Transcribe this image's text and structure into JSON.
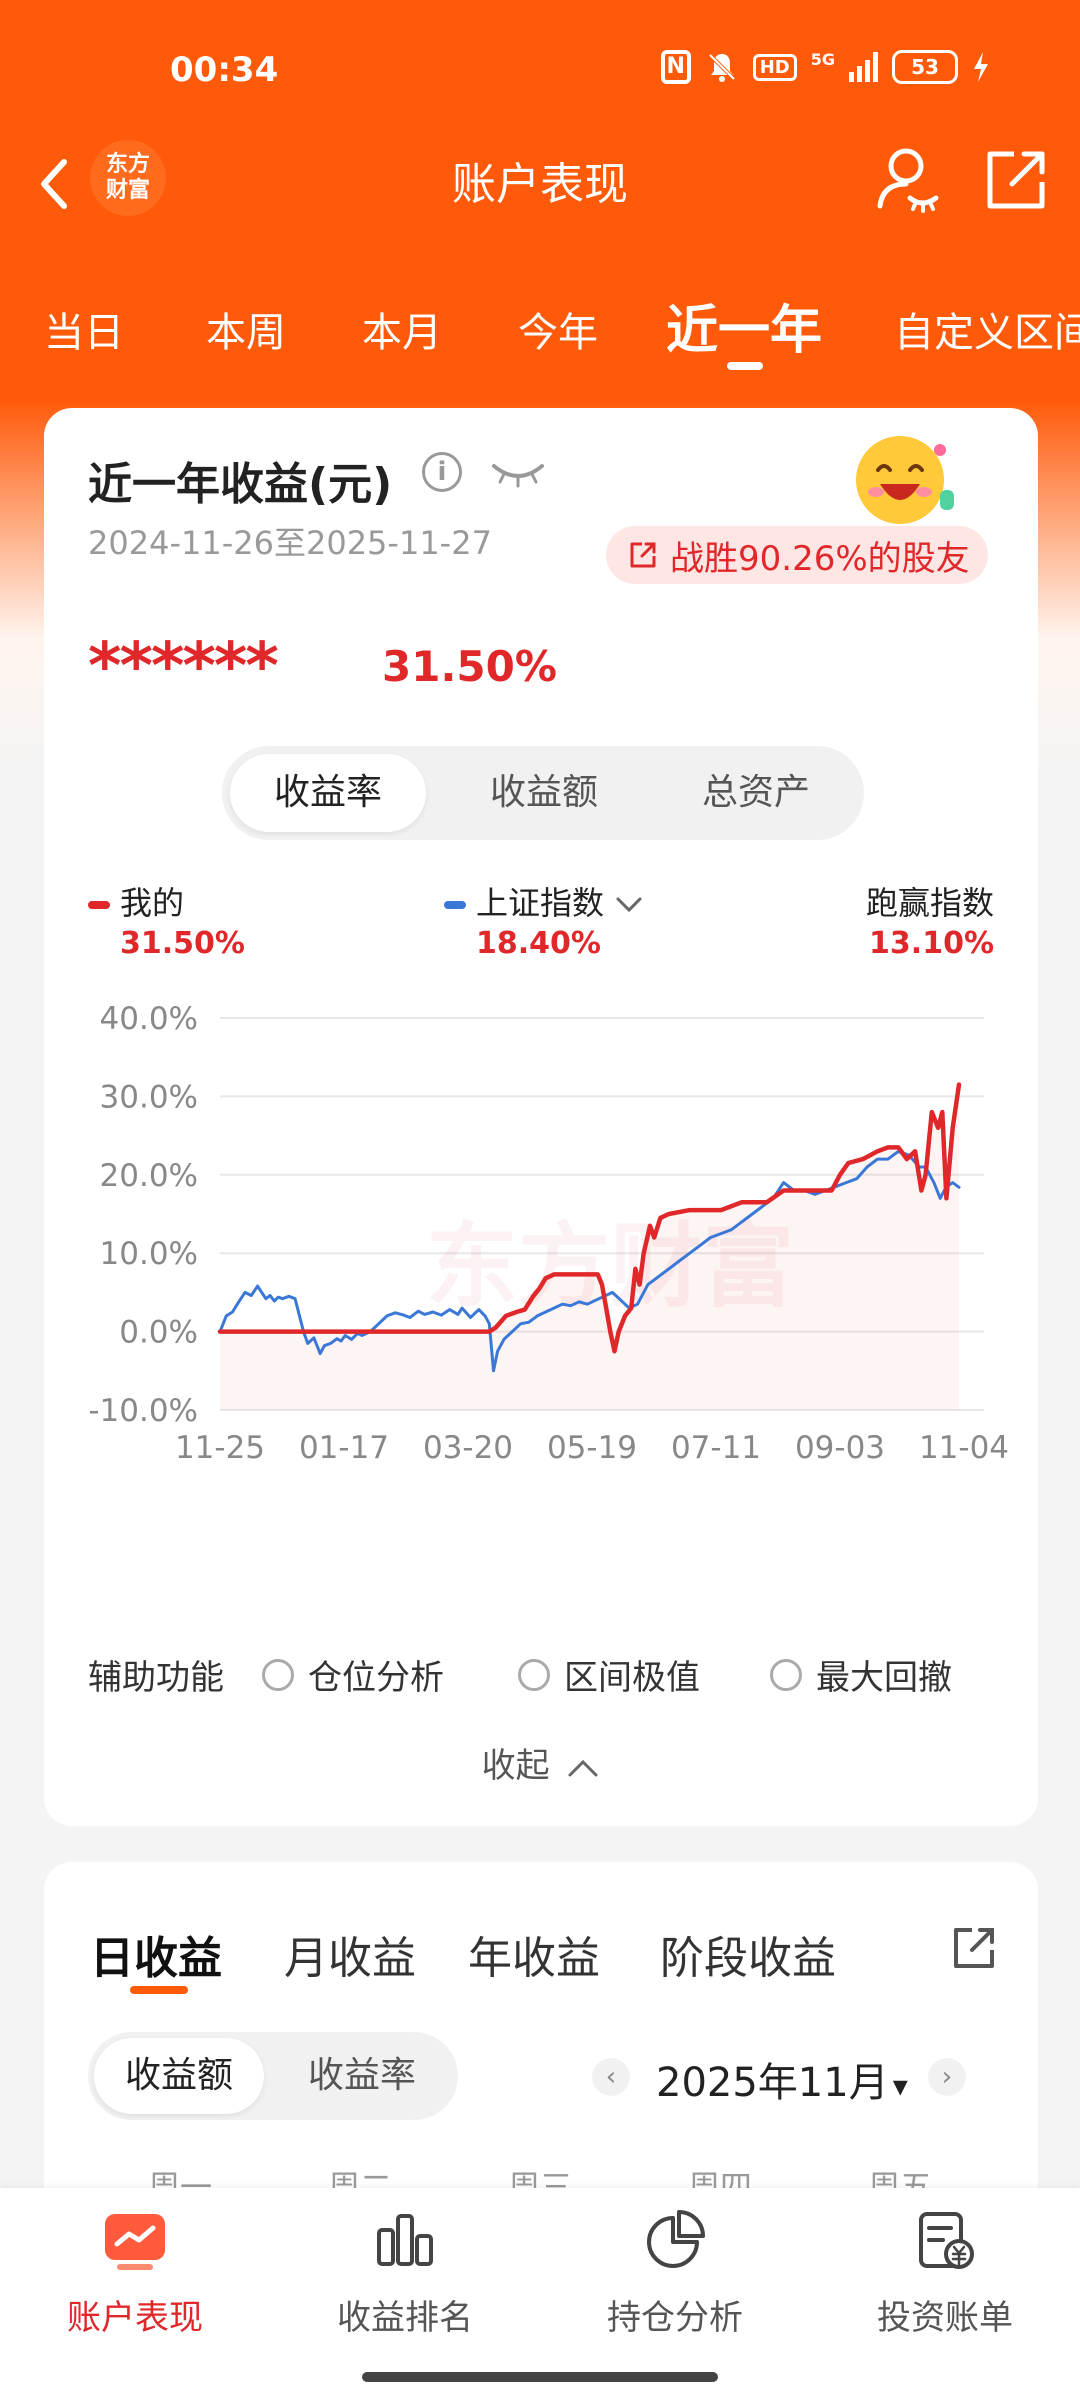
{
  "status_bar": {
    "time": "00:34",
    "network": "5G",
    "hd": "HD",
    "nfc": "N",
    "battery": "53"
  },
  "header": {
    "title": "账户表现",
    "logo_line1": "东方",
    "logo_line2": "财富"
  },
  "period_tabs": [
    "当日",
    "本周",
    "本月",
    "今年",
    "近一年",
    "自定义区间"
  ],
  "period_tab_active": "近一年",
  "summary": {
    "title": "近一年收益(元)",
    "info_glyph": "i",
    "date_range": "2024-11-26至2025-11-27",
    "beat_text": "战胜90.26%的股友",
    "amount_masked": "******",
    "return_rate": "31.50%"
  },
  "metric_segment": [
    "收益率",
    "收益额",
    "总资产"
  ],
  "metric_segment_active": "收益率",
  "legend": {
    "mine_label": "我的",
    "mine_value": "31.50%",
    "index_label": "上证指数",
    "index_value": "18.40%",
    "outperform_label": "跑赢指数",
    "outperform_value": "13.10%"
  },
  "colors": {
    "brand": "#ff5a0a",
    "mine": "#e0282b",
    "index": "#3a78d8",
    "grid": "#e8e8e8"
  },
  "watermark_text": "东方财富",
  "chart_data": {
    "type": "line",
    "y_tick_labels": [
      "40.0%",
      "30.0%",
      "20.0%",
      "10.0%",
      "0.0%",
      "-10.0%"
    ],
    "x_tick_labels": [
      "11-25",
      "01-17",
      "03-20",
      "05-19",
      "07-11",
      "09-03",
      "11-04"
    ],
    "ylim": [
      -10,
      40
    ],
    "grid": true,
    "x_range_days": [
      0,
      366
    ],
    "series": [
      {
        "name": "我的",
        "color": "#e0282b",
        "points": [
          [
            0,
            0
          ],
          [
            30,
            0
          ],
          [
            60,
            0
          ],
          [
            90,
            0
          ],
          [
            120,
            0
          ],
          [
            129,
            0
          ],
          [
            132,
            0.5
          ],
          [
            137,
            2
          ],
          [
            142,
            2.5
          ],
          [
            146,
            2.8
          ],
          [
            150,
            4.5
          ],
          [
            153,
            5.5
          ],
          [
            156,
            6.8
          ],
          [
            160,
            7.3
          ],
          [
            168,
            7.3
          ],
          [
            176,
            7.3
          ],
          [
            181,
            7.3
          ],
          [
            183,
            6
          ],
          [
            185,
            3
          ],
          [
            187,
            0
          ],
          [
            189,
            -2.5
          ],
          [
            191,
            0
          ],
          [
            194,
            2
          ],
          [
            197,
            3
          ],
          [
            199,
            8
          ],
          [
            201,
            6
          ],
          [
            203,
            10
          ],
          [
            206,
            13.5
          ],
          [
            208,
            12
          ],
          [
            211,
            14.5
          ],
          [
            215,
            15
          ],
          [
            225,
            15.5
          ],
          [
            240,
            15.5
          ],
          [
            250,
            16.5
          ],
          [
            262,
            16.5
          ],
          [
            270,
            18
          ],
          [
            285,
            18
          ],
          [
            293,
            18
          ],
          [
            297,
            20
          ],
          [
            301,
            21.5
          ],
          [
            308,
            22
          ],
          [
            315,
            23
          ],
          [
            320,
            23.5
          ],
          [
            325,
            23.5
          ],
          [
            329,
            22
          ],
          [
            333,
            23
          ],
          [
            336,
            18
          ],
          [
            338,
            20
          ],
          [
            341,
            28
          ],
          [
            344,
            26
          ],
          [
            346,
            28
          ],
          [
            348,
            17
          ],
          [
            351,
            26
          ],
          [
            354,
            31.5
          ]
        ]
      },
      {
        "name": "上证指数",
        "color": "#3a78d8",
        "points": [
          [
            0,
            0
          ],
          [
            3,
            2
          ],
          [
            6,
            2.5
          ],
          [
            9,
            3.8
          ],
          [
            12,
            5
          ],
          [
            15,
            4.6
          ],
          [
            18,
            5.8
          ],
          [
            20,
            5
          ],
          [
            22,
            4.2
          ],
          [
            24,
            4.6
          ],
          [
            26,
            3.9
          ],
          [
            28,
            4.4
          ],
          [
            30,
            4.2
          ],
          [
            33,
            4.5
          ],
          [
            36,
            4.2
          ],
          [
            40,
            0
          ],
          [
            42,
            -1.5
          ],
          [
            45,
            -0.8
          ],
          [
            48,
            -2.8
          ],
          [
            50,
            -1.8
          ],
          [
            53,
            -1.5
          ],
          [
            56,
            -0.9
          ],
          [
            58,
            -1.2
          ],
          [
            60,
            -0.5
          ],
          [
            63,
            -1
          ],
          [
            66,
            -0.2
          ],
          [
            68,
            -0.5
          ],
          [
            72,
            0
          ],
          [
            76,
            1
          ],
          [
            80,
            2
          ],
          [
            84,
            2.4
          ],
          [
            88,
            2.1
          ],
          [
            91,
            1.8
          ],
          [
            95,
            2.6
          ],
          [
            98,
            2.2
          ],
          [
            102,
            2.5
          ],
          [
            106,
            2.1
          ],
          [
            110,
            2.8
          ],
          [
            114,
            2.2
          ],
          [
            116,
            3
          ],
          [
            120,
            1.8
          ],
          [
            124,
            2.8
          ],
          [
            127,
            2
          ],
          [
            129,
            1
          ],
          [
            130,
            -2
          ],
          [
            131,
            -5
          ],
          [
            133,
            -2.5
          ],
          [
            136,
            -1
          ],
          [
            140,
            0
          ],
          [
            144,
            1
          ],
          [
            148,
            1.2
          ],
          [
            152,
            2
          ],
          [
            156,
            2.5
          ],
          [
            160,
            3
          ],
          [
            164,
            3.5
          ],
          [
            168,
            3.3
          ],
          [
            172,
            3.8
          ],
          [
            176,
            3.5
          ],
          [
            180,
            4
          ],
          [
            184,
            4.5
          ],
          [
            188,
            5
          ],
          [
            192,
            4
          ],
          [
            196,
            3
          ],
          [
            200,
            3.5
          ],
          [
            205,
            6
          ],
          [
            210,
            7
          ],
          [
            215,
            8
          ],
          [
            220,
            9
          ],
          [
            225,
            10
          ],
          [
            230,
            11
          ],
          [
            235,
            12
          ],
          [
            240,
            12.5
          ],
          [
            245,
            13
          ],
          [
            250,
            14
          ],
          [
            255,
            15
          ],
          [
            260,
            16
          ],
          [
            265,
            17
          ],
          [
            270,
            19
          ],
          [
            275,
            18
          ],
          [
            280,
            18
          ],
          [
            285,
            17.5
          ],
          [
            290,
            18
          ],
          [
            295,
            18.5
          ],
          [
            300,
            19
          ],
          [
            305,
            19.5
          ],
          [
            310,
            21
          ],
          [
            315,
            22
          ],
          [
            320,
            22
          ],
          [
            325,
            23
          ],
          [
            330,
            22.5
          ],
          [
            335,
            21
          ],
          [
            338,
            21
          ],
          [
            342,
            19
          ],
          [
            345,
            17
          ],
          [
            348,
            18.5
          ],
          [
            351,
            19
          ],
          [
            354,
            18.4
          ]
        ]
      }
    ]
  },
  "assist": {
    "label": "辅助功能",
    "options": [
      "仓位分析",
      "区间极值",
      "最大回撤"
    ]
  },
  "collapse_label": "收起",
  "income_tabs": [
    "日收益",
    "月收益",
    "年收益",
    "阶段收益"
  ],
  "income_tab_active": "日收益",
  "value_segment": [
    "收益额",
    "收益率"
  ],
  "value_segment_active": "收益额",
  "month": {
    "label": "2025年11月",
    "dropdown": "▾",
    "prev": "‹",
    "next": "›"
  },
  "weekdays": [
    "周一",
    "周二",
    "周三",
    "周四",
    "周五"
  ],
  "bottom_nav": [
    "账户表现",
    "收益排名",
    "持仓分析",
    "投资账单"
  ],
  "bottom_nav_active": "账户表现"
}
